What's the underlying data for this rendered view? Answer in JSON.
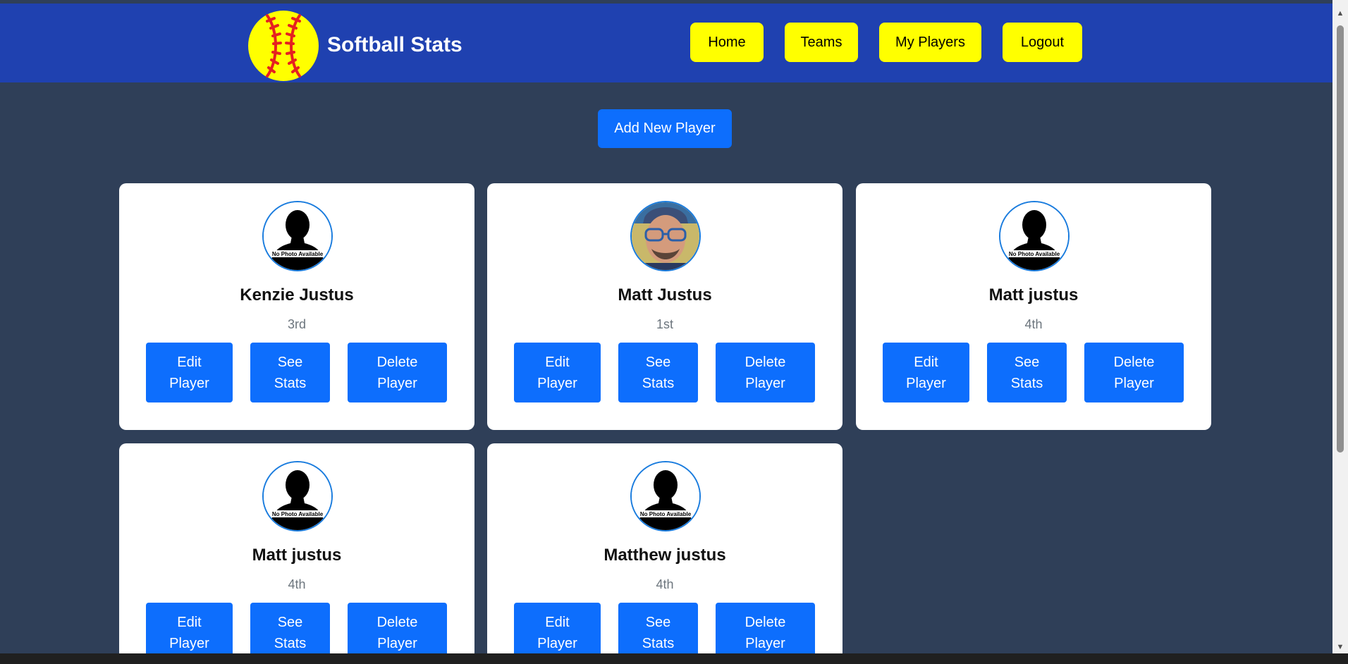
{
  "app": {
    "title": "Softball Stats"
  },
  "nav": {
    "items": [
      {
        "label": "Home"
      },
      {
        "label": "Teams"
      },
      {
        "label": "My Players"
      },
      {
        "label": "Logout"
      }
    ]
  },
  "actions": {
    "add_player_label": "Add New Player"
  },
  "players": [
    {
      "name": "Kenzie Justus",
      "position": "3rd",
      "photo": "no-photo",
      "photo_caption": "No Photo Available",
      "edit_label": [
        "Edit",
        "Player"
      ],
      "stats_label": [
        "See",
        "Stats"
      ],
      "delete_label": [
        "Delete",
        "Player"
      ]
    },
    {
      "name": "Matt Justus",
      "position": "1st",
      "photo": "user-photo",
      "photo_caption": "",
      "edit_label": [
        "Edit",
        "Player"
      ],
      "stats_label": [
        "See",
        "Stats"
      ],
      "delete_label": [
        "Delete",
        "Player"
      ]
    },
    {
      "name": "Matt justus",
      "position": "4th",
      "photo": "no-photo",
      "photo_caption": "No Photo Available",
      "edit_label": [
        "Edit",
        "Player"
      ],
      "stats_label": [
        "See",
        "Stats"
      ],
      "delete_label": [
        "Delete",
        "Player"
      ]
    },
    {
      "name": "Matt justus",
      "position": "4th",
      "photo": "no-photo",
      "photo_caption": "No Photo Available",
      "edit_label": [
        "Edit",
        "Player"
      ],
      "stats_label": [
        "See",
        "Stats"
      ],
      "delete_label": [
        "Delete",
        "Player"
      ]
    },
    {
      "name": "Matthew justus",
      "position": "4th",
      "photo": "no-photo",
      "photo_caption": "No Photo Available",
      "edit_label": [
        "Edit",
        "Player"
      ],
      "stats_label": [
        "See",
        "Stats"
      ],
      "delete_label": [
        "Delete",
        "Player"
      ]
    }
  ],
  "colors": {
    "navbar": "#1f41b0",
    "background": "#2f3f58",
    "nav_button": "#ffff00",
    "primary_button": "#0d6efd",
    "ball": "#ffff00",
    "ball_stitches": "#e52020"
  },
  "icons": {
    "logo": "softball-logo-icon",
    "placeholder": "silhouette-icon",
    "scroll_up": "chevron-up-icon",
    "scroll_down": "chevron-down-icon"
  }
}
